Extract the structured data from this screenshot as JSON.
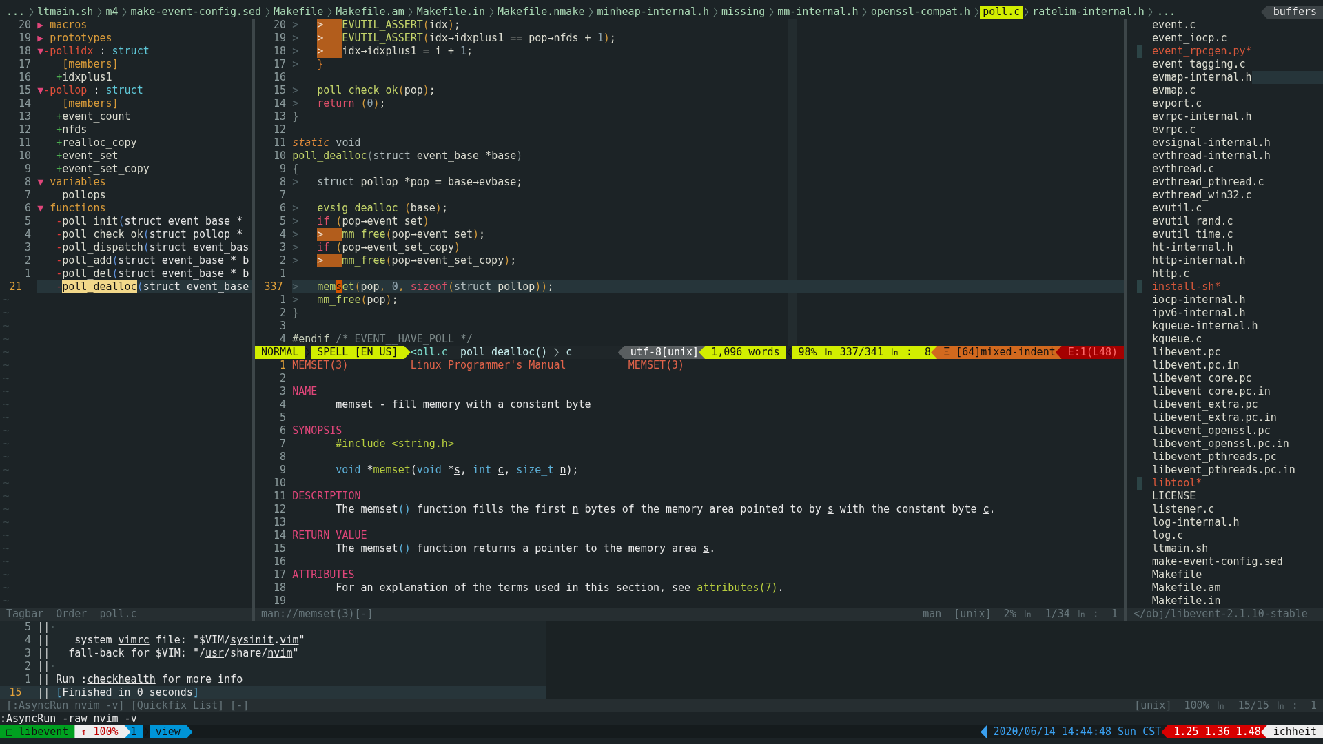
{
  "tabline": {
    "tabs": [
      {
        "label": "...",
        "selected": false
      },
      {
        "label": "ltmain.sh",
        "selected": false
      },
      {
        "label": "m4",
        "selected": false
      },
      {
        "label": "make-event-config.sed",
        "selected": false
      },
      {
        "label": "Makefile",
        "selected": false
      },
      {
        "label": "Makefile.am",
        "selected": false
      },
      {
        "label": "Makefile.in",
        "selected": false
      },
      {
        "label": "Makefile.nmake",
        "selected": false
      },
      {
        "label": "minheap-internal.h",
        "selected": false
      },
      {
        "label": "missing",
        "selected": false
      },
      {
        "label": "mm-internal.h",
        "selected": false
      },
      {
        "label": "openssl-compat.h",
        "selected": false
      },
      {
        "label": "poll.c",
        "selected": true
      },
      {
        "label": "ratelim-internal.h",
        "selected": false
      },
      {
        "label": "...",
        "selected": false
      }
    ],
    "label": "buffers"
  },
  "tagbar": {
    "rows": [
      {
        "num": "20",
        "fold": "▶",
        "name": "macros",
        "kind": "group",
        "current": false
      },
      {
        "num": "19",
        "fold": "▶",
        "name": "prototypes",
        "kind": "group",
        "current": false
      },
      {
        "num": "18",
        "fold": "▼",
        "sign": {
          "mark": "-",
          "kind": "private"
        },
        "name": "pollidx",
        "kind": "scope",
        "sep": ":",
        "type": "struct",
        "current": false,
        "children": [
          {
            "num": "17",
            "name": "[members]",
            "kind": "group",
            "current": false
          },
          {
            "num": "16",
            "sign": {
              "mark": "+",
              "kind": "public"
            },
            "name": "idxplus1",
            "kind": "plain",
            "current": false
          }
        ]
      },
      {
        "num": "15",
        "fold": "▼",
        "sign": {
          "mark": "-",
          "kind": "private"
        },
        "name": "pollop",
        "kind": "scope",
        "sep": ":",
        "type": "struct",
        "current": false,
        "children": [
          {
            "num": "14",
            "name": "[members]",
            "kind": "group",
            "current": false
          },
          {
            "num": "13",
            "sign": {
              "mark": "+",
              "kind": "public"
            },
            "name": "event_count",
            "kind": "plain",
            "current": false
          },
          {
            "num": "12",
            "sign": {
              "mark": "+",
              "kind": "public"
            },
            "name": "nfds",
            "kind": "plain",
            "current": false
          },
          {
            "num": "11",
            "sign": {
              "mark": "+",
              "kind": "public"
            },
            "name": "realloc_copy",
            "kind": "plain",
            "current": false
          },
          {
            "num": "10",
            "sign": {
              "mark": "+",
              "kind": "public"
            },
            "name": "event_set",
            "kind": "plain",
            "current": false
          },
          {
            "num": "9",
            "sign": {
              "mark": "+",
              "kind": "public"
            },
            "name": "event_set_copy",
            "kind": "plain",
            "current": false
          }
        ]
      },
      {
        "num": "8",
        "fold": "▼",
        "name": "variables",
        "kind": "group",
        "current": false,
        "children": [
          {
            "num": "7",
            "name": "pollops",
            "kind": "plain",
            "current": false
          }
        ]
      },
      {
        "num": "6",
        "fold": "▼",
        "name": "functions",
        "kind": "group",
        "current": false,
        "children": [
          {
            "num": "5",
            "sign": {
              "mark": "-",
              "kind": "private"
            },
            "name": "poll_init",
            "kind": "plain",
            "paren": "(",
            "args": "struct event_base *",
            "current": false
          },
          {
            "num": "4",
            "sign": {
              "mark": "-",
              "kind": "private"
            },
            "name": "poll_check_ok",
            "kind": "plain",
            "paren": "(",
            "args": "struct pollop *",
            "current": false
          },
          {
            "num": "3",
            "sign": {
              "mark": "-",
              "kind": "private"
            },
            "name": "poll_dispatch",
            "kind": "plain",
            "paren": "(",
            "args": "struct event_bas",
            "current": false
          },
          {
            "num": "2",
            "sign": {
              "mark": "-",
              "kind": "private"
            },
            "name": "poll_add",
            "kind": "plain",
            "paren": "(",
            "args": "struct event_base * b",
            "current": false
          },
          {
            "num": "1",
            "sign": {
              "mark": "-",
              "kind": "private"
            },
            "name": "poll_del",
            "kind": "plain",
            "paren": "(",
            "args": "struct event_base * b",
            "current": false
          },
          {
            "num": "21",
            "sign": {
              "mark": "-",
              "kind": "private"
            },
            "name": "poll_dealloc",
            "kind": "plain",
            "paren": "(",
            "args": "struct event_base",
            "current": true
          }
        ]
      }
    ],
    "tildes": [
      "~",
      "~",
      "~",
      "~",
      "~",
      "~",
      "~",
      "~",
      "~",
      "~",
      "~",
      "~",
      "~",
      "~",
      "~",
      "~",
      "~",
      "~",
      "~",
      "~",
      "~",
      "~",
      "~",
      "~"
    ]
  },
  "editor": {
    "lines": [
      {
        "num": "20",
        "current": false,
        "tabs": [
          {
            "mark": ">",
            "warn": false
          },
          {
            "mark": ">",
            "warn": true
          }
        ],
        "tokens": [
          {
            "kind": "fn",
            "text": "EVUTIL_ASSERT"
          },
          {
            "kind": "paren",
            "text": "("
          },
          {
            "kind": "id",
            "text": "idx"
          },
          {
            "kind": "paren",
            "text": ")"
          },
          {
            "kind": "id",
            "text": ";"
          }
        ]
      },
      {
        "num": "19",
        "current": false,
        "tabs": [
          {
            "mark": ">",
            "warn": false
          },
          {
            "mark": ">",
            "warn": true
          }
        ],
        "tokens": [
          {
            "kind": "fn",
            "text": "EVUTIL_ASSERT"
          },
          {
            "kind": "paren",
            "text": "("
          },
          {
            "kind": "id",
            "text": "idx→idxplus1 == pop→nfds + "
          },
          {
            "kind": "num",
            "text": "1"
          },
          {
            "kind": "paren",
            "text": ")"
          },
          {
            "kind": "id",
            "text": ";"
          }
        ]
      },
      {
        "num": "18",
        "current": false,
        "tabs": [
          {
            "mark": ">",
            "warn": false
          },
          {
            "mark": ">",
            "warn": true
          }
        ],
        "tokens": [
          {
            "kind": "id",
            "text": "idx→idxplus1 = i + "
          },
          {
            "kind": "num",
            "text": "1"
          },
          {
            "kind": "id",
            "text": ";"
          }
        ]
      },
      {
        "num": "17",
        "current": false,
        "tabs": [
          {
            "mark": ">",
            "warn": false
          }
        ],
        "tokens": [
          {
            "kind": "brace",
            "text": "}"
          }
        ]
      },
      {
        "num": "16",
        "current": false
      },
      {
        "num": "15",
        "current": false,
        "tabs": [
          {
            "mark": ">",
            "warn": false
          }
        ],
        "tokens": [
          {
            "kind": "fn",
            "text": "poll_check_ok"
          },
          {
            "kind": "paren",
            "text": "("
          },
          {
            "kind": "id",
            "text": "pop"
          },
          {
            "kind": "paren",
            "text": ")"
          },
          {
            "kind": "id",
            "text": ";"
          }
        ]
      },
      {
        "num": "14",
        "current": false,
        "tabs": [
          {
            "mark": ">",
            "warn": false
          }
        ],
        "tokens": [
          {
            "kind": "kw",
            "text": "return"
          },
          {
            "kind": "paren",
            "text": " ("
          },
          {
            "kind": "num",
            "text": "0"
          },
          {
            "kind": "paren",
            "text": ")"
          },
          {
            "kind": "id",
            "text": ";"
          }
        ]
      },
      {
        "num": "13",
        "current": false,
        "tokens": [
          {
            "kind": "punct",
            "text": "}"
          }
        ]
      },
      {
        "num": "12",
        "current": false
      },
      {
        "num": "11",
        "current": false,
        "tokens": [
          {
            "kind": "storage",
            "text": "static"
          },
          {
            "kind": "type",
            "text": " void"
          }
        ]
      },
      {
        "num": "10",
        "current": false,
        "tokens": [
          {
            "kind": "fn",
            "text": "poll_dealloc"
          },
          {
            "kind": "punct",
            "text": "("
          },
          {
            "kind": "type",
            "text": "struct"
          },
          {
            "kind": "id",
            "text": " event_base *base"
          },
          {
            "kind": "punct",
            "text": ")"
          }
        ]
      },
      {
        "num": "9",
        "current": false,
        "tokens": [
          {
            "kind": "punct",
            "text": "{"
          }
        ]
      },
      {
        "num": "8",
        "current": false,
        "tabs": [
          {
            "mark": ">",
            "warn": false
          }
        ],
        "tokens": [
          {
            "kind": "type",
            "text": "struct"
          },
          {
            "kind": "id",
            "text": " pollop *pop = base→evbase;"
          }
        ]
      },
      {
        "num": "7",
        "current": false
      },
      {
        "num": "6",
        "current": false,
        "tabs": [
          {
            "mark": ">",
            "warn": false
          }
        ],
        "tokens": [
          {
            "kind": "fn",
            "text": "evsig_dealloc_"
          },
          {
            "kind": "paren",
            "text": "("
          },
          {
            "kind": "id",
            "text": "base"
          },
          {
            "kind": "paren",
            "text": ")"
          },
          {
            "kind": "id",
            "text": ";"
          }
        ]
      },
      {
        "num": "5",
        "current": false,
        "tabs": [
          {
            "mark": ">",
            "warn": false
          }
        ],
        "tokens": [
          {
            "kind": "kw",
            "text": "if"
          },
          {
            "kind": "paren",
            "text": " ("
          },
          {
            "kind": "id",
            "text": "pop→event_set"
          },
          {
            "kind": "paren",
            "text": ")"
          }
        ]
      },
      {
        "num": "4",
        "current": false,
        "tabs": [
          {
            "mark": ">",
            "warn": false
          },
          {
            "mark": ">",
            "warn": true
          }
        ],
        "tokens": [
          {
            "kind": "fn",
            "text": "mm_free"
          },
          {
            "kind": "paren",
            "text": "("
          },
          {
            "kind": "id",
            "text": "pop→event_set"
          },
          {
            "kind": "paren",
            "text": ")"
          },
          {
            "kind": "id",
            "text": ";"
          }
        ]
      },
      {
        "num": "3",
        "current": false,
        "tabs": [
          {
            "mark": ">",
            "warn": false
          }
        ],
        "tokens": [
          {
            "kind": "kw",
            "text": "if"
          },
          {
            "kind": "paren",
            "text": " ("
          },
          {
            "kind": "id",
            "text": "pop→event_set_copy"
          },
          {
            "kind": "paren",
            "text": ")"
          }
        ]
      },
      {
        "num": "2",
        "current": false,
        "tabs": [
          {
            "mark": ">",
            "warn": false
          },
          {
            "mark": ">",
            "warn": true
          }
        ],
        "tokens": [
          {
            "kind": "fn",
            "text": "mm_free"
          },
          {
            "kind": "paren",
            "text": "("
          },
          {
            "kind": "id",
            "text": "pop→event_set_copy"
          },
          {
            "kind": "paren",
            "text": ")"
          },
          {
            "kind": "id",
            "text": ";"
          }
        ]
      },
      {
        "num": "1",
        "current": false
      },
      {
        "num": "337",
        "current": true,
        "tabs": [
          {
            "mark": ">",
            "warn": false
          }
        ],
        "tokens": [
          {
            "kind": "fn",
            "text": "mem"
          },
          {
            "kind": "cursor",
            "text": "s"
          },
          {
            "kind": "fn",
            "text": "et"
          },
          {
            "kind": "paren",
            "text": "("
          },
          {
            "kind": "id",
            "text": "pop"
          },
          {
            "kind": "paren",
            "text": ", "
          },
          {
            "kind": "num",
            "text": "0"
          },
          {
            "kind": "paren",
            "text": ", "
          },
          {
            "kind": "kw",
            "text": "sizeof"
          },
          {
            "kind": "paren",
            "text": "("
          },
          {
            "kind": "type",
            "text": "struct"
          },
          {
            "kind": "id",
            "text": " pollop"
          },
          {
            "kind": "paren",
            "text": "))"
          },
          {
            "kind": "id",
            "text": ";"
          }
        ]
      },
      {
        "num": "1",
        "current": false,
        "tabs": [
          {
            "mark": ">",
            "warn": false
          }
        ],
        "tokens": [
          {
            "kind": "fn",
            "text": "mm_free"
          },
          {
            "kind": "paren",
            "text": "("
          },
          {
            "kind": "id",
            "text": "pop"
          },
          {
            "kind": "paren",
            "text": ")"
          },
          {
            "kind": "id",
            "text": ";"
          }
        ]
      },
      {
        "num": "2",
        "current": false,
        "tokens": [
          {
            "kind": "punct",
            "text": "}"
          }
        ]
      },
      {
        "num": "3",
        "current": false
      },
      {
        "num": "4",
        "current": false,
        "tokens": [
          {
            "kind": "pre",
            "text": "#endif"
          },
          {
            "kind": "comment",
            "text": " /* EVENT__HAVE_POLL */"
          }
        ]
      }
    ]
  },
  "statusline": {
    "left": [
      {
        "kind": "mode",
        "text": "NORMAL"
      },
      {
        "kind": "lime",
        "text": "SPELL [EN_US]",
        "arrow": true,
        "divider": true
      },
      {
        "kind": "file",
        "text": "<oll.c"
      },
      {
        "kind": "func",
        "text": "poll_dealloc()"
      },
      {
        "kind": "func",
        "text": "c",
        "divider": true
      }
    ],
    "right": [
      {
        "kind": "gray",
        "text": "utf-8[unix]",
        "arrow": true
      },
      {
        "kind": "lime",
        "text": "1,096 words",
        "arrow": true
      },
      {
        "kind": "lime",
        "text": "98% ㏑ 337/341 ㏑ :  8",
        "divider": true
      },
      {
        "kind": "orange",
        "text": "Ξ [64]mixed-indent",
        "arrow": true
      },
      {
        "kind": "red",
        "text": "E:1(L48)",
        "arrow": true
      }
    ]
  },
  "man": {
    "lines": [
      {
        "num": "1",
        "current": true,
        "tokens": [
          {
            "kind": "head",
            "text": "MEMSET(3)          Linux Programmer's Manual          MEMSET(3)"
          }
        ]
      },
      {
        "num": "2",
        "current": false
      },
      {
        "num": "3",
        "current": false,
        "tokens": [
          {
            "kind": "sec",
            "text": "NAME"
          }
        ]
      },
      {
        "num": "4",
        "current": false,
        "indent": true,
        "tokens": [
          {
            "kind": "text",
            "text": "memset - fill memory with a constant byte"
          }
        ]
      },
      {
        "num": "5",
        "current": false
      },
      {
        "num": "6",
        "current": false,
        "tokens": [
          {
            "kind": "sec",
            "text": "SYNOPSIS"
          }
        ]
      },
      {
        "num": "7",
        "current": false,
        "indent": true,
        "tokens": [
          {
            "kind": "green",
            "text": "#include <string.h>"
          }
        ]
      },
      {
        "num": "8",
        "current": false
      },
      {
        "num": "9",
        "current": false,
        "indent": true,
        "tokens": [
          {
            "kind": "blue",
            "text": "void"
          },
          {
            "kind": "text",
            "text": " *"
          },
          {
            "kind": "green",
            "text": "memset"
          },
          {
            "kind": "text",
            "text": "("
          },
          {
            "kind": "blue",
            "text": "void"
          },
          {
            "kind": "text",
            "text": " *"
          },
          {
            "kind": "ul",
            "text": "s"
          },
          {
            "kind": "text",
            "text": ", "
          },
          {
            "kind": "blue",
            "text": "int "
          },
          {
            "kind": "ul",
            "text": "c"
          },
          {
            "kind": "text",
            "text": ", "
          },
          {
            "kind": "blue",
            "text": "size_t "
          },
          {
            "kind": "ul",
            "text": "n"
          },
          {
            "kind": "text",
            "text": ");"
          }
        ]
      },
      {
        "num": "10",
        "current": false
      },
      {
        "num": "11",
        "current": false,
        "tokens": [
          {
            "kind": "sec",
            "text": "DESCRIPTION"
          }
        ]
      },
      {
        "num": "12",
        "current": false,
        "indent": true,
        "tokens": [
          {
            "kind": "text",
            "text": "The memset"
          },
          {
            "kind": "blue",
            "text": "()"
          },
          {
            "kind": "text",
            "text": " function fills the first "
          },
          {
            "kind": "ul",
            "text": "n"
          },
          {
            "kind": "text",
            "text": " bytes of the memory area pointed to by "
          },
          {
            "kind": "ul",
            "text": "s"
          },
          {
            "kind": "text",
            "text": " with the constant byte "
          },
          {
            "kind": "ul",
            "text": "c"
          },
          {
            "kind": "text",
            "text": "."
          }
        ]
      },
      {
        "num": "13",
        "current": false
      },
      {
        "num": "14",
        "current": false,
        "tokens": [
          {
            "kind": "sec",
            "text": "RETURN VALUE"
          }
        ]
      },
      {
        "num": "15",
        "current": false,
        "indent": true,
        "tokens": [
          {
            "kind": "text",
            "text": "The memset"
          },
          {
            "kind": "blue",
            "text": "()"
          },
          {
            "kind": "text",
            "text": " function returns a pointer to the memory area "
          },
          {
            "kind": "ul",
            "text": "s"
          },
          {
            "kind": "text",
            "text": "."
          }
        ]
      },
      {
        "num": "16",
        "current": false
      },
      {
        "num": "17",
        "current": false,
        "tokens": [
          {
            "kind": "sec",
            "text": "ATTRIBUTES"
          }
        ]
      },
      {
        "num": "18",
        "current": false,
        "indent": true,
        "tokens": [
          {
            "kind": "text",
            "text": "For an explanation of the terms used in this section, see "
          },
          {
            "kind": "green",
            "text": "attributes(7)"
          },
          {
            "kind": "text",
            "text": "."
          }
        ]
      },
      {
        "num": "19",
        "current": false
      }
    ]
  },
  "buffers": {
    "files": [
      {
        "name": "event.c",
        "modified": false,
        "cursor": false
      },
      {
        "name": "event_iocp.c",
        "modified": false,
        "cursor": false
      },
      {
        "name": "event_rpcgen.py*",
        "modified": true,
        "cursor": false
      },
      {
        "name": "event_tagging.c",
        "modified": false,
        "cursor": false
      },
      {
        "name": "evmap-internal.h",
        "modified": false,
        "cursor": true
      },
      {
        "name": "evmap.c",
        "modified": false,
        "cursor": false
      },
      {
        "name": "evport.c",
        "modified": false,
        "cursor": false
      },
      {
        "name": "evrpc-internal.h",
        "modified": false,
        "cursor": false
      },
      {
        "name": "evrpc.c",
        "modified": false,
        "cursor": false
      },
      {
        "name": "evsignal-internal.h",
        "modified": false,
        "cursor": false
      },
      {
        "name": "evthread-internal.h",
        "modified": false,
        "cursor": false
      },
      {
        "name": "evthread.c",
        "modified": false,
        "cursor": false
      },
      {
        "name": "evthread_pthread.c",
        "modified": false,
        "cursor": false
      },
      {
        "name": "evthread_win32.c",
        "modified": false,
        "cursor": false
      },
      {
        "name": "evutil.c",
        "modified": false,
        "cursor": false
      },
      {
        "name": "evutil_rand.c",
        "modified": false,
        "cursor": false
      },
      {
        "name": "evutil_time.c",
        "modified": false,
        "cursor": false
      },
      {
        "name": "ht-internal.h",
        "modified": false,
        "cursor": false
      },
      {
        "name": "http-internal.h",
        "modified": false,
        "cursor": false
      },
      {
        "name": "http.c",
        "modified": false,
        "cursor": false
      },
      {
        "name": "install-sh*",
        "modified": true,
        "cursor": false
      },
      {
        "name": "iocp-internal.h",
        "modified": false,
        "cursor": false
      },
      {
        "name": "ipv6-internal.h",
        "modified": false,
        "cursor": false
      },
      {
        "name": "kqueue-internal.h",
        "modified": false,
        "cursor": false
      },
      {
        "name": "kqueue.c",
        "modified": false,
        "cursor": false
      },
      {
        "name": "libevent.pc",
        "modified": false,
        "cursor": false
      },
      {
        "name": "libevent.pc.in",
        "modified": false,
        "cursor": false
      },
      {
        "name": "libevent_core.pc",
        "modified": false,
        "cursor": false
      },
      {
        "name": "libevent_core.pc.in",
        "modified": false,
        "cursor": false
      },
      {
        "name": "libevent_extra.pc",
        "modified": false,
        "cursor": false
      },
      {
        "name": "libevent_extra.pc.in",
        "modified": false,
        "cursor": false
      },
      {
        "name": "libevent_openssl.pc",
        "modified": false,
        "cursor": false
      },
      {
        "name": "libevent_openssl.pc.in",
        "modified": false,
        "cursor": false
      },
      {
        "name": "libevent_pthreads.pc",
        "modified": false,
        "cursor": false
      },
      {
        "name": "libevent_pthreads.pc.in",
        "modified": false,
        "cursor": false
      },
      {
        "name": "libtool*",
        "modified": true,
        "cursor": false
      },
      {
        "name": "LICENSE",
        "modified": false,
        "cursor": false
      },
      {
        "name": "listener.c",
        "modified": false,
        "cursor": false
      },
      {
        "name": "log-internal.h",
        "modified": false,
        "cursor": false
      },
      {
        "name": "log.c",
        "modified": false,
        "cursor": false
      },
      {
        "name": "ltmain.sh",
        "modified": false,
        "cursor": false
      },
      {
        "name": "make-event-config.sed",
        "modified": false,
        "cursor": false
      },
      {
        "name": "Makefile",
        "modified": false,
        "cursor": false
      },
      {
        "name": "Makefile.am",
        "modified": false,
        "cursor": false
      },
      {
        "name": "Makefile.in",
        "modified": false,
        "cursor": false
      }
    ]
  },
  "window_status": {
    "tagbar": [
      "Tagbar",
      "Order",
      "poll.c"
    ],
    "man_left": "man://memset(3)[-]",
    "man_right": [
      "man",
      "[unix]",
      "2% ㏑",
      "1/34 ㏑ :  1"
    ],
    "buffers": "</obj/libevent-2.1.10-stable"
  },
  "quickfix": {
    "lines": [
      {
        "num": "5",
        "current": false,
        "tokens": [
          {
            "kind": "bar",
            "text": "||"
          },
          {
            "kind": "faint",
            "text": "·"
          }
        ]
      },
      {
        "num": "4",
        "current": false,
        "tokens": [
          {
            "kind": "bar",
            "text": "||"
          },
          {
            "kind": "text",
            "text": "    system "
          },
          {
            "kind": "ul",
            "text": "vimrc"
          },
          {
            "kind": "text",
            "text": " file: \"$VIM/"
          },
          {
            "kind": "ul",
            "text": "sysinit"
          },
          {
            "kind": "text",
            "text": "."
          },
          {
            "kind": "ul",
            "text": "vim"
          },
          {
            "kind": "text",
            "text": "\""
          }
        ]
      },
      {
        "num": "3",
        "current": false,
        "tokens": [
          {
            "kind": "bar",
            "text": "||"
          },
          {
            "kind": "text",
            "text": "   fall-back for $VIM: \"/"
          },
          {
            "kind": "ul",
            "text": "usr"
          },
          {
            "kind": "text",
            "text": "/share/"
          },
          {
            "kind": "ul",
            "text": "nvim"
          },
          {
            "kind": "text",
            "text": "\""
          }
        ]
      },
      {
        "num": "2",
        "current": false,
        "tokens": [
          {
            "kind": "bar",
            "text": "||"
          },
          {
            "kind": "faint",
            "text": "·"
          }
        ]
      },
      {
        "num": "1",
        "current": false,
        "tokens": [
          {
            "kind": "bar",
            "text": "||"
          },
          {
            "kind": "text",
            "text": " Run :"
          },
          {
            "kind": "ul",
            "text": "checkhealth"
          },
          {
            "kind": "text",
            "text": " for more info"
          }
        ]
      },
      {
        "num": "15",
        "current": true,
        "tokens": [
          {
            "kind": "bar",
            "text": "|| "
          },
          {
            "kind": "blue",
            "text": "["
          },
          {
            "kind": "text",
            "text": "Finished in 0 seconds"
          },
          {
            "kind": "blue",
            "text": "]"
          }
        ]
      }
    ],
    "status_left": "[:AsyncRun nvim -v] [Quickfix List] [-]",
    "status_right": [
      "[unix]",
      "100% ㏑",
      "15/15 ㏑ :  1"
    ]
  },
  "cmdline": ":AsyncRun -raw nvim -v",
  "tmux": {
    "left": [
      {
        "kind": "green",
        "text": "□ libevent",
        "arrow": true
      },
      {
        "kind": "white",
        "text": "↑ 100%",
        "arrow": true
      },
      {
        "kind": "blue",
        "text": "1"
      },
      {
        "kind": "blue",
        "text": "view",
        "divider": true,
        "arrow": true
      }
    ],
    "right": [
      {
        "kind": "date",
        "text": "2020/06/14 14:44:48 Sun CST"
      },
      {
        "kind": "red",
        "text": "1.25 1.36 1.48",
        "arrow": true
      },
      {
        "kind": "white",
        "text": "ichheit",
        "arrow": true
      }
    ]
  }
}
